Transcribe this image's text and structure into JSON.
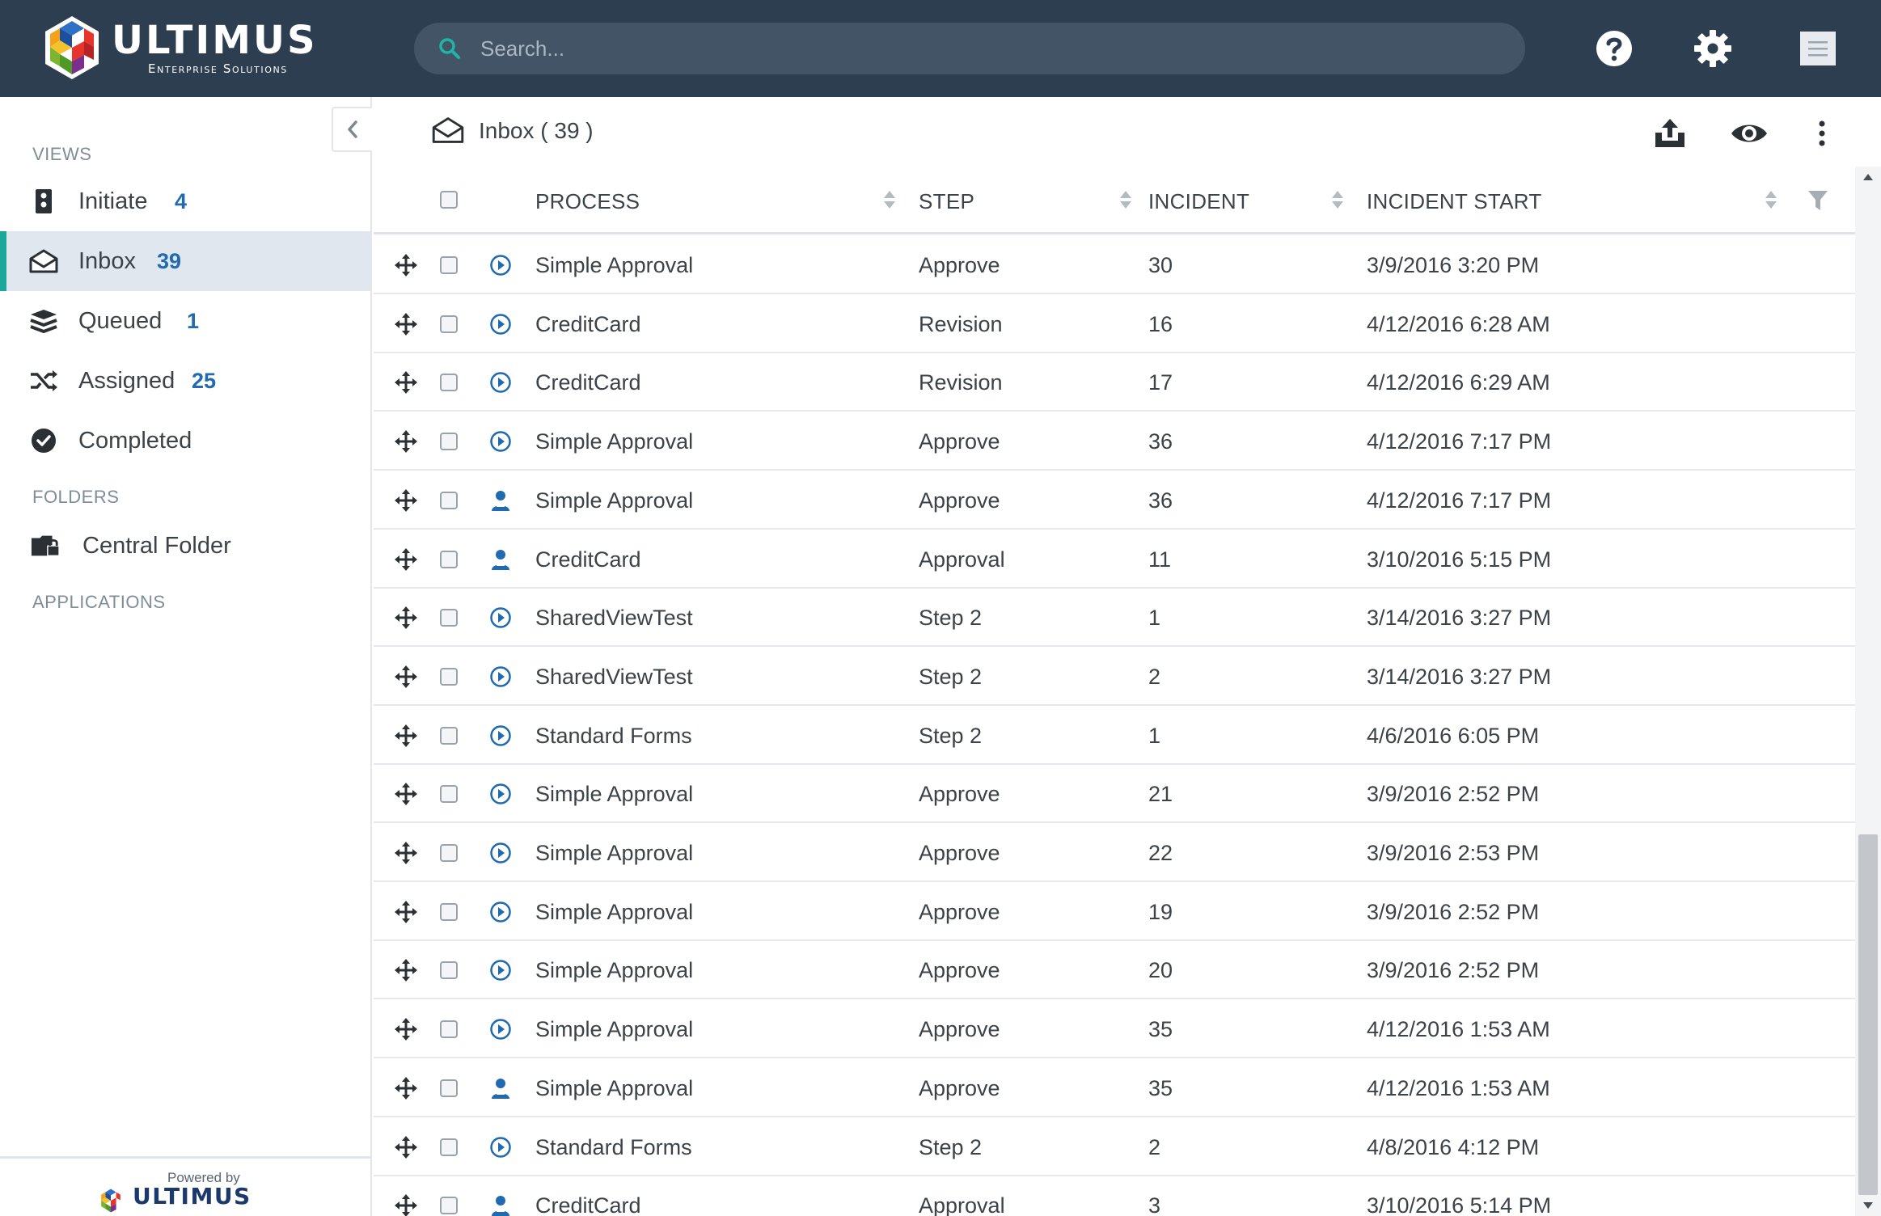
{
  "header": {
    "logo_name": "ULTIMUS",
    "logo_tagline": "Enterprise Solutions",
    "search_placeholder": "Search...",
    "icons": [
      "search-icon",
      "help-icon",
      "gear-icon",
      "menu-icon"
    ]
  },
  "sidebar": {
    "views_heading": "VIEWS",
    "views": [
      {
        "label": "Initiate",
        "count": "4",
        "icon": "initiate-icon",
        "active": false
      },
      {
        "label": "Inbox",
        "count": "39",
        "icon": "inbox-icon",
        "active": true
      },
      {
        "label": "Queued",
        "count": "1",
        "icon": "stack-icon",
        "active": false
      },
      {
        "label": "Assigned",
        "count": "25",
        "icon": "shuffle-icon",
        "active": false
      },
      {
        "label": "Completed",
        "count": "",
        "icon": "check-circle-icon",
        "active": false
      }
    ],
    "folders_heading": "FOLDERS",
    "folders": [
      {
        "label": "Central Folder",
        "icon": "folder-lock-icon"
      }
    ],
    "applications_heading": "APPLICATIONS",
    "footer": {
      "powered_by": "Powered by",
      "brand": "ULTIMUS"
    }
  },
  "colors": {
    "header_bg": "#2c3e50",
    "search_bg": "#435466",
    "accent_teal": "#1aa89a",
    "count_blue": "#1f6ab0",
    "active_bg": "#e1e7ee",
    "task_icon_blue": "#1f6ab0"
  },
  "main": {
    "title": "Inbox ( 39 )",
    "toolbar_icons": [
      "export-icon",
      "eye-icon",
      "more-vertical-icon"
    ],
    "columns": {
      "process": "PROCESS",
      "step": "STEP",
      "incident": "INCIDENT",
      "incident_start": "INCIDENT START"
    },
    "rows": [
      {
        "type": "play",
        "process": "Simple Approval",
        "step": "Approve",
        "incident": "30",
        "start": "3/9/2016 3:20 PM"
      },
      {
        "type": "play",
        "process": "CreditCard",
        "step": "Revision",
        "incident": "16",
        "start": "4/12/2016 6:28 AM"
      },
      {
        "type": "play",
        "process": "CreditCard",
        "step": "Revision",
        "incident": "17",
        "start": "4/12/2016 6:29 AM"
      },
      {
        "type": "play",
        "process": "Simple Approval",
        "step": "Approve",
        "incident": "36",
        "start": "4/12/2016 7:17 PM"
      },
      {
        "type": "user",
        "process": "Simple Approval",
        "step": "Approve",
        "incident": "36",
        "start": "4/12/2016 7:17 PM"
      },
      {
        "type": "user",
        "process": "CreditCard",
        "step": "Approval",
        "incident": "11",
        "start": "3/10/2016 5:15 PM"
      },
      {
        "type": "play",
        "process": "SharedViewTest",
        "step": "Step 2",
        "incident": "1",
        "start": "3/14/2016 3:27 PM"
      },
      {
        "type": "play",
        "process": "SharedViewTest",
        "step": "Step 2",
        "incident": "2",
        "start": "3/14/2016 3:27 PM"
      },
      {
        "type": "play",
        "process": "Standard Forms",
        "step": "Step 2",
        "incident": "1",
        "start": "4/6/2016 6:05 PM"
      },
      {
        "type": "play",
        "process": "Simple Approval",
        "step": "Approve",
        "incident": "21",
        "start": "3/9/2016 2:52 PM"
      },
      {
        "type": "play",
        "process": "Simple Approval",
        "step": "Approve",
        "incident": "22",
        "start": "3/9/2016 2:53 PM"
      },
      {
        "type": "play",
        "process": "Simple Approval",
        "step": "Approve",
        "incident": "19",
        "start": "3/9/2016 2:52 PM"
      },
      {
        "type": "play",
        "process": "Simple Approval",
        "step": "Approve",
        "incident": "20",
        "start": "3/9/2016 2:52 PM"
      },
      {
        "type": "play",
        "process": "Simple Approval",
        "step": "Approve",
        "incident": "35",
        "start": "4/12/2016 1:53 AM"
      },
      {
        "type": "user",
        "process": "Simple Approval",
        "step": "Approve",
        "incident": "35",
        "start": "4/12/2016 1:53 AM"
      },
      {
        "type": "play",
        "process": "Standard Forms",
        "step": "Step 2",
        "incident": "2",
        "start": "4/8/2016 4:12 PM"
      },
      {
        "type": "user",
        "process": "CreditCard",
        "step": "Approval",
        "incident": "3",
        "start": "3/10/2016 5:14 PM"
      }
    ]
  }
}
